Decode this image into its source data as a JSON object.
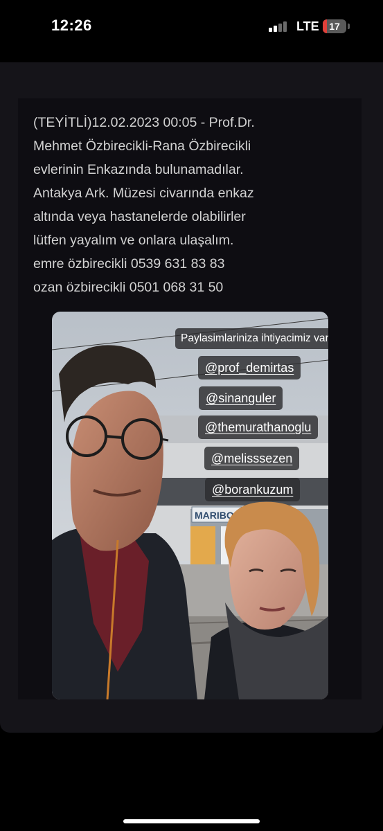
{
  "status_bar": {
    "time": "12:26",
    "network": "LTE",
    "battery_level": "17",
    "battery_color": "#e0403a",
    "signal_bars_active": 2,
    "signal_bars_total": 4
  },
  "post": {
    "lines": [
      "(TEYİTLİ)12.02.2023 00:05 - Prof.Dr.",
      "Mehmet Özbirecikli-Rana Özbirecikli",
      "evlerinin Enkazında bulunamadılar.",
      "Antakya Ark. Müzesi civarında enkaz",
      "altında veya hastanelerde olabilirler",
      "lütfen yayalım ve onlara ulaşalım.",
      "emre özbirecikli 0539 631 83 83",
      "ozan özbirecikli 0501 068 31 50"
    ]
  },
  "story": {
    "caption": "Paylasimlariniza ihtiyacimiz var",
    "caption_emoji": "🙏🏻",
    "mentions": [
      "@prof_demirtas",
      "@sinanguler",
      "@themurathanoglu",
      "@melisssezen",
      "@borankuzum"
    ],
    "station_sign": "MARIBOR"
  }
}
